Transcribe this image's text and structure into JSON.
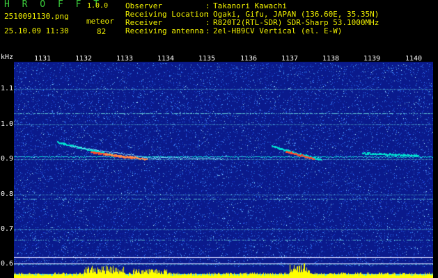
{
  "header": {
    "app_title": "H R O F F T",
    "app_version": "1.0.0",
    "file_name": "2510091130.png",
    "date_time": "25.10.09 11:30",
    "mode_label": "meteor",
    "count_value": "82",
    "info": [
      {
        "label": "Observer",
        "value": "Takanori Kawachi"
      },
      {
        "label": "Receiving Location",
        "value": "Ogaki, Gifu, JAPAN (136.60E, 35.35N)"
      },
      {
        "label": "Receiver",
        "value": "R820T2(RTL-SDR) SDR-Sharp 53.1000MHz"
      },
      {
        "label": "Receiving antenna",
        "value": "2el-HB9CV Vertical (el. E-W)"
      }
    ]
  },
  "spectrogram": {
    "y_unit": "kHz",
    "y_ticks": [
      "1.1",
      "1.0",
      "0.9",
      "0.8",
      "0.7",
      "0.6"
    ],
    "x_ticks": [
      "1131",
      "1132",
      "1133",
      "1134",
      "1135",
      "1136",
      "1137",
      "1138",
      "1139",
      "1140"
    ],
    "colors": {
      "background": "#0a1a8c",
      "noise": "#2f6cff",
      "trace": "#00e0d0",
      "meteor": "#ff4a2a",
      "bars": "#ffff00"
    }
  }
}
